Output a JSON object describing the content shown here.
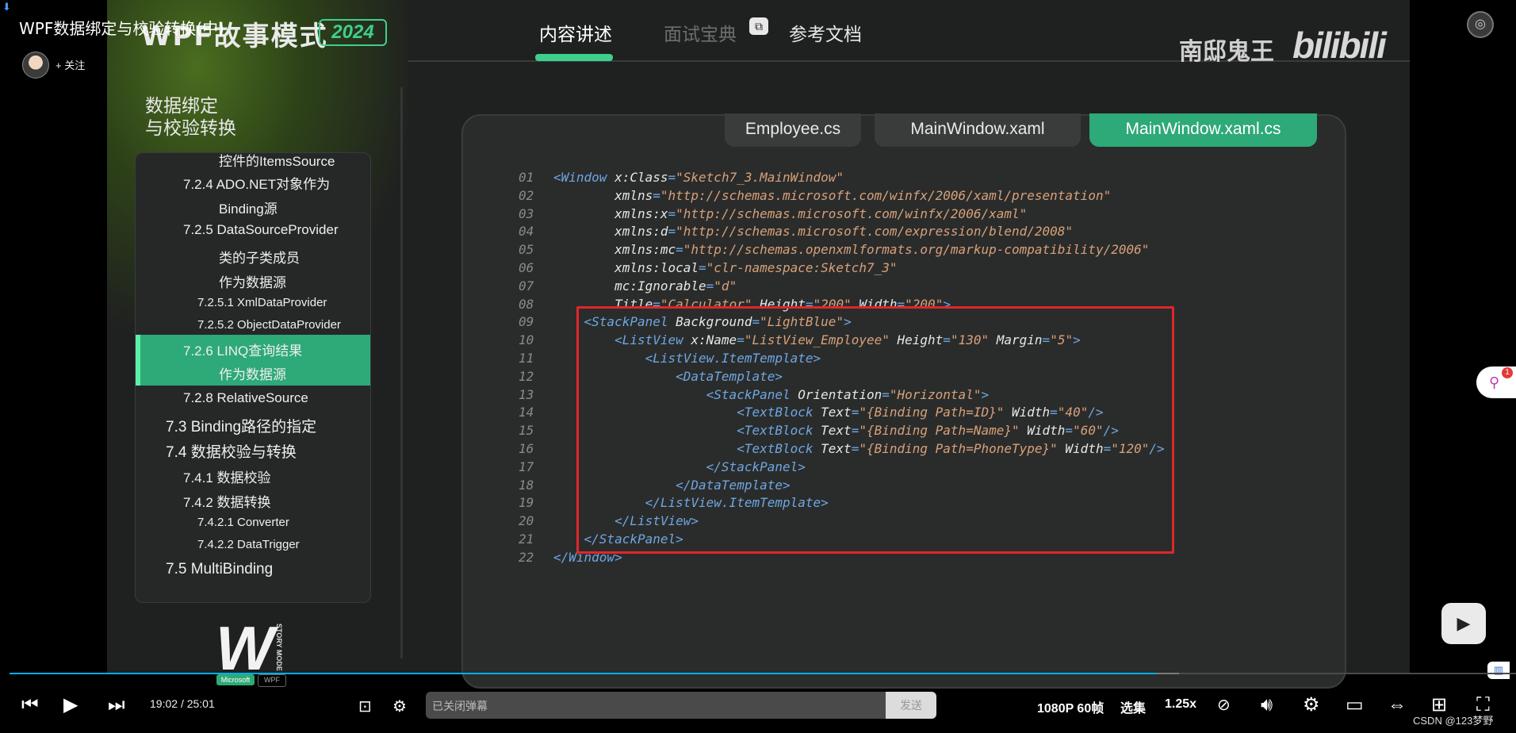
{
  "video": {
    "title": "WPF数据绑定与校验转换(中)",
    "follow_label": "+ 关注"
  },
  "header": {
    "brand_title": "WPF故事模式",
    "brand_year": "2024",
    "tabs": [
      {
        "label": "内容讲述",
        "state": "active"
      },
      {
        "label": "面试宝典",
        "state": "muted"
      },
      {
        "label": "参考文档",
        "state": "normal"
      }
    ],
    "watermark_text": "南邸鬼王",
    "watermark_logo": "bilibili"
  },
  "sidebar": {
    "section_title_line1": "数据绑定",
    "section_title_line2": "与校验转换",
    "items": [
      {
        "label": "控件的ItemsSource"
      },
      {
        "label": "7.2.4 ADO.NET对象作为"
      },
      {
        "label": "Binding源"
      },
      {
        "label": "7.2.5 DataSourceProvider"
      },
      {
        "label": "类的子类成员"
      },
      {
        "label": "作为数据源"
      },
      {
        "label": "7.2.5.1 XmlDataProvider"
      },
      {
        "label": "7.2.5.2 ObjectDataProvider"
      },
      {
        "label": "7.2.6 LINQ查询结果"
      },
      {
        "label": "作为数据源"
      },
      {
        "label": "7.2.8 RelativeSource"
      },
      {
        "label": "7.3 Binding路径的指定"
      },
      {
        "label": "7.4 数据校验与转换"
      },
      {
        "label": "7.4.1 数据校验"
      },
      {
        "label": "7.4.2 数据转换"
      },
      {
        "label": "7.4.2.1 Converter"
      },
      {
        "label": "7.4.2.2 DataTrigger"
      },
      {
        "label": "7.5 MultiBinding"
      }
    ],
    "active_item": "7.2.6 LINQ查询结果",
    "logo": {
      "mark": "W",
      "side": "STORY MODE",
      "tag1": "Microsoft",
      "tag2": "WPF"
    }
  },
  "editor": {
    "tabs": [
      {
        "label": "Employee.cs",
        "active": false
      },
      {
        "label": "MainWindow.xaml",
        "active": false
      },
      {
        "label": "MainWindow.xaml.cs",
        "active": true
      }
    ],
    "lines": [
      {
        "num": "01",
        "parts": [
          [
            "tg",
            "<Window "
          ],
          [
            "at",
            "x:Class"
          ],
          [
            "tg",
            "="
          ],
          [
            "vl",
            "\"Sketch7_3.MainWindow\""
          ]
        ]
      },
      {
        "num": "02",
        "parts": [
          [
            "at",
            "        xmlns"
          ],
          [
            "tg",
            "="
          ],
          [
            "vl",
            "\"http://schemas.microsoft.com/winfx/2006/xaml/presentation\""
          ]
        ]
      },
      {
        "num": "03",
        "parts": [
          [
            "at",
            "        xmlns:x"
          ],
          [
            "tg",
            "="
          ],
          [
            "vl",
            "\"http://schemas.microsoft.com/winfx/2006/xaml\""
          ]
        ]
      },
      {
        "num": "04",
        "parts": [
          [
            "at",
            "        xmlns:d"
          ],
          [
            "tg",
            "="
          ],
          [
            "vl",
            "\"http://schemas.microsoft.com/expression/blend/2008\""
          ]
        ]
      },
      {
        "num": "05",
        "parts": [
          [
            "at",
            "        xmlns:mc"
          ],
          [
            "tg",
            "="
          ],
          [
            "vl",
            "\"http://schemas.openxmlformats.org/markup-compatibility/2006\""
          ]
        ]
      },
      {
        "num": "06",
        "parts": [
          [
            "at",
            "        xmlns:local"
          ],
          [
            "tg",
            "="
          ],
          [
            "vl",
            "\"clr-namespace:Sketch7_3\""
          ]
        ]
      },
      {
        "num": "07",
        "parts": [
          [
            "at",
            "        mc:Ignorable"
          ],
          [
            "tg",
            "="
          ],
          [
            "vl",
            "\"d\""
          ]
        ]
      },
      {
        "num": "08",
        "parts": [
          [
            "at",
            "        Title"
          ],
          [
            "tg",
            "="
          ],
          [
            "vl",
            "\"Calculator\""
          ],
          [
            "at",
            " Height"
          ],
          [
            "tg",
            "="
          ],
          [
            "vl",
            "\"200\""
          ],
          [
            "at",
            " Width"
          ],
          [
            "tg",
            "="
          ],
          [
            "vl",
            "\"200\""
          ],
          [
            "tg",
            ">"
          ]
        ]
      },
      {
        "num": "09",
        "parts": [
          [
            "tg",
            "    <StackPanel "
          ],
          [
            "at",
            "Background"
          ],
          [
            "tg",
            "="
          ],
          [
            "vl",
            "\"LightBlue\""
          ],
          [
            "tg",
            ">"
          ]
        ]
      },
      {
        "num": "10",
        "parts": [
          [
            "tg",
            "        <ListView "
          ],
          [
            "at",
            "x:Name"
          ],
          [
            "tg",
            "="
          ],
          [
            "vl",
            "\"ListView_Employee\""
          ],
          [
            "at",
            " Height"
          ],
          [
            "tg",
            "="
          ],
          [
            "vl",
            "\"130\""
          ],
          [
            "at",
            " Margin"
          ],
          [
            "tg",
            "="
          ],
          [
            "vl",
            "\"5\""
          ],
          [
            "tg",
            ">"
          ]
        ]
      },
      {
        "num": "11",
        "parts": [
          [
            "tg",
            "            <ListView.ItemTemplate>"
          ]
        ]
      },
      {
        "num": "12",
        "parts": [
          [
            "tg",
            "                <DataTemplate>"
          ]
        ]
      },
      {
        "num": "13",
        "parts": [
          [
            "tg",
            "                    <StackPanel "
          ],
          [
            "at",
            "Orientation"
          ],
          [
            "tg",
            "="
          ],
          [
            "vl",
            "\"Horizontal\""
          ],
          [
            "tg",
            ">"
          ]
        ]
      },
      {
        "num": "14",
        "parts": [
          [
            "tg",
            "                        <TextBlock "
          ],
          [
            "at",
            "Text"
          ],
          [
            "tg",
            "="
          ],
          [
            "vl",
            "\"{Binding Path=ID}\""
          ],
          [
            "at",
            " Width"
          ],
          [
            "tg",
            "="
          ],
          [
            "vl",
            "\"40\""
          ],
          [
            "tg",
            "/>"
          ]
        ]
      },
      {
        "num": "15",
        "parts": [
          [
            "tg",
            "                        <TextBlock "
          ],
          [
            "at",
            "Text"
          ],
          [
            "tg",
            "="
          ],
          [
            "vl",
            "\"{Binding Path=Name}\""
          ],
          [
            "at",
            " Width"
          ],
          [
            "tg",
            "="
          ],
          [
            "vl",
            "\"60\""
          ],
          [
            "tg",
            "/>"
          ]
        ]
      },
      {
        "num": "16",
        "parts": [
          [
            "tg",
            "                        <TextBlock "
          ],
          [
            "at",
            "Text"
          ],
          [
            "tg",
            "="
          ],
          [
            "vl",
            "\"{Binding Path=PhoneType}\""
          ],
          [
            "at",
            " Width"
          ],
          [
            "tg",
            "="
          ],
          [
            "vl",
            "\"120\""
          ],
          [
            "tg",
            "/>"
          ]
        ]
      },
      {
        "num": "17",
        "parts": [
          [
            "tg",
            "                    </StackPanel>"
          ]
        ]
      },
      {
        "num": "18",
        "parts": [
          [
            "tg",
            "                </DataTemplate>"
          ]
        ]
      },
      {
        "num": "19",
        "parts": [
          [
            "tg",
            "            </ListView.ItemTemplate>"
          ]
        ]
      },
      {
        "num": "20",
        "parts": [
          [
            "tg",
            "        </ListView>"
          ]
        ]
      },
      {
        "num": "21",
        "parts": [
          [
            "tg",
            "    </StackPanel>"
          ]
        ]
      },
      {
        "num": "22",
        "parts": [
          [
            "tg",
            "</Window>"
          ]
        ]
      }
    ]
  },
  "player": {
    "current_time": "19:02",
    "total_time": "25:01",
    "progress": 0.7608,
    "danmaku_placeholder": "已关闭弹幕",
    "send_label": "发送",
    "quality_label": "1080P 60帧",
    "episodes_label": "选集",
    "speed_label": "1.25x",
    "badge_count": "1"
  },
  "footer": {
    "csdn_watermark": "CSDN @123梦野"
  },
  "colors": {
    "accent_green": "#2ea978",
    "highlight_red": "#e0262b",
    "progress_blue": "#00aeec",
    "code_tag": "#6fa6e0",
    "code_value": "#d9a078"
  }
}
